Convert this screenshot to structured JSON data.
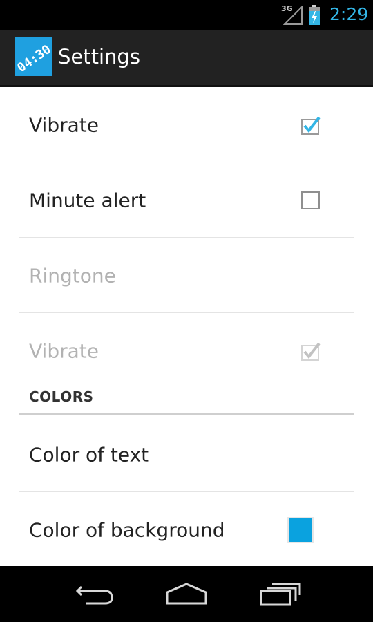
{
  "status_bar": {
    "network": "3G",
    "time": "2:29",
    "accent_color": "#33b5e5",
    "icons": [
      "signal-icon",
      "battery-charging-icon"
    ]
  },
  "action_bar": {
    "app_icon_text": "04:30",
    "title": "Settings"
  },
  "settings": [
    {
      "label": "Vibrate",
      "control": "checkbox",
      "checked": true,
      "enabled": true
    },
    {
      "label": "Minute alert",
      "control": "checkbox",
      "checked": false,
      "enabled": true
    },
    {
      "label": "Ringtone",
      "control": "none",
      "enabled": false
    },
    {
      "label": "Vibrate",
      "control": "checkbox",
      "checked": true,
      "enabled": false
    }
  ],
  "colors_section": {
    "header": "COLORS",
    "items": [
      {
        "label": "Color of text",
        "control": "none"
      },
      {
        "label": "Color of background",
        "control": "swatch",
        "swatch_color": "#0aa2df"
      }
    ]
  },
  "nav_bar": {
    "buttons": [
      "back-icon",
      "home-icon",
      "recent-apps-icon"
    ]
  }
}
